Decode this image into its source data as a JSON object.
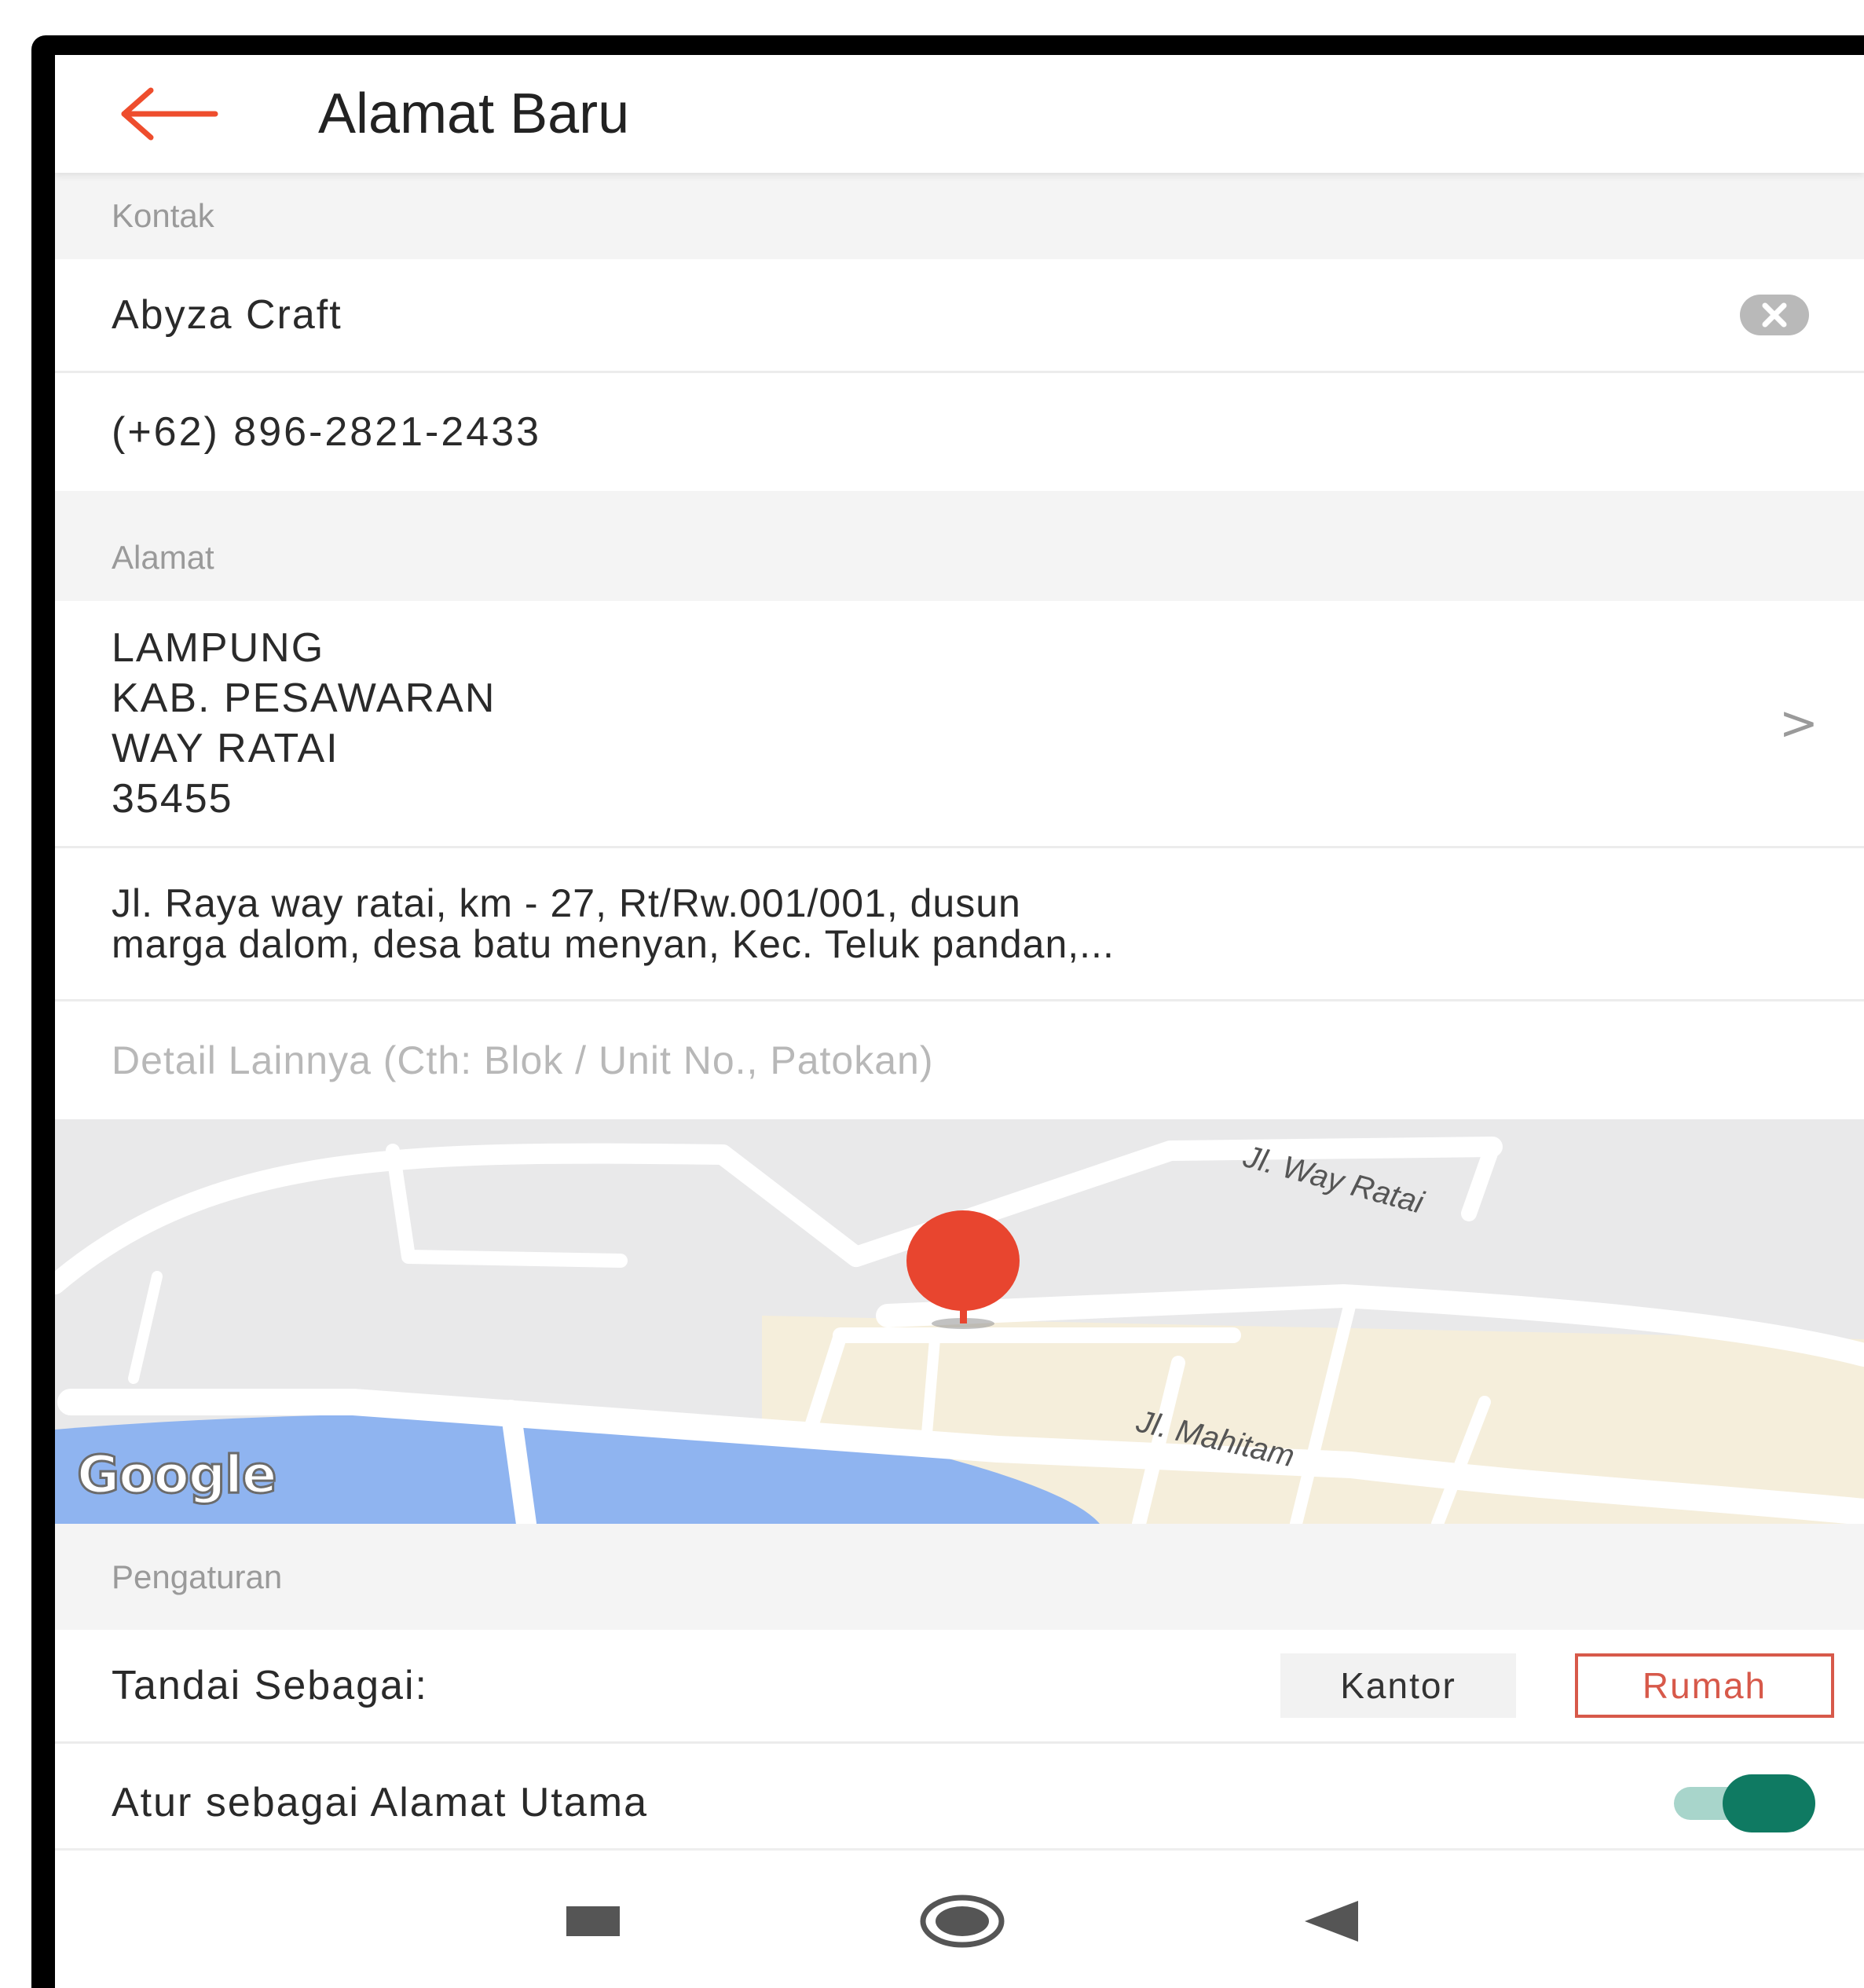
{
  "header": {
    "title": "Alamat Baru",
    "back_icon": "arrow-left-icon",
    "accent_color": "#ee4d2d"
  },
  "contact": {
    "section_label": "Kontak",
    "name": "Abyza Craft",
    "phone": "(+62) 896-2821-2433",
    "clear_icon": "clear-circle-icon"
  },
  "address": {
    "section_label": "Alamat",
    "region_lines": [
      "LAMPUNG",
      "KAB. PESAWARAN",
      "WAY RATAI",
      "35455"
    ],
    "street": "Jl. Raya way ratai, km - 27, Rt/Rw.001/001, dusun\nmarga dalom, desa batu menyan, Kec. Teluk pandan,...",
    "detail_placeholder": "Detail Lainnya (Cth: Blok / Unit No., Patokan)",
    "detail_value": ""
  },
  "map": {
    "road_label_1": "Jl. Way Ratai",
    "road_label_2": "Jl. Mahitam",
    "provider_logo": "Google",
    "pin_color": "#e8452f",
    "water_color": "#8fb4f0"
  },
  "settings": {
    "section_label": "Pengaturan",
    "mark_as_label": "Tandai Sebagai:",
    "options": [
      "Kantor",
      "Rumah"
    ],
    "selected_option": "Rumah",
    "primary_address_label": "Atur sebagai Alamat Utama",
    "primary_address_enabled": true,
    "toggle_color": "#0f7a62"
  },
  "navbar": {
    "icons": [
      "recent-apps-icon",
      "home-icon",
      "back-triangle-icon"
    ]
  }
}
